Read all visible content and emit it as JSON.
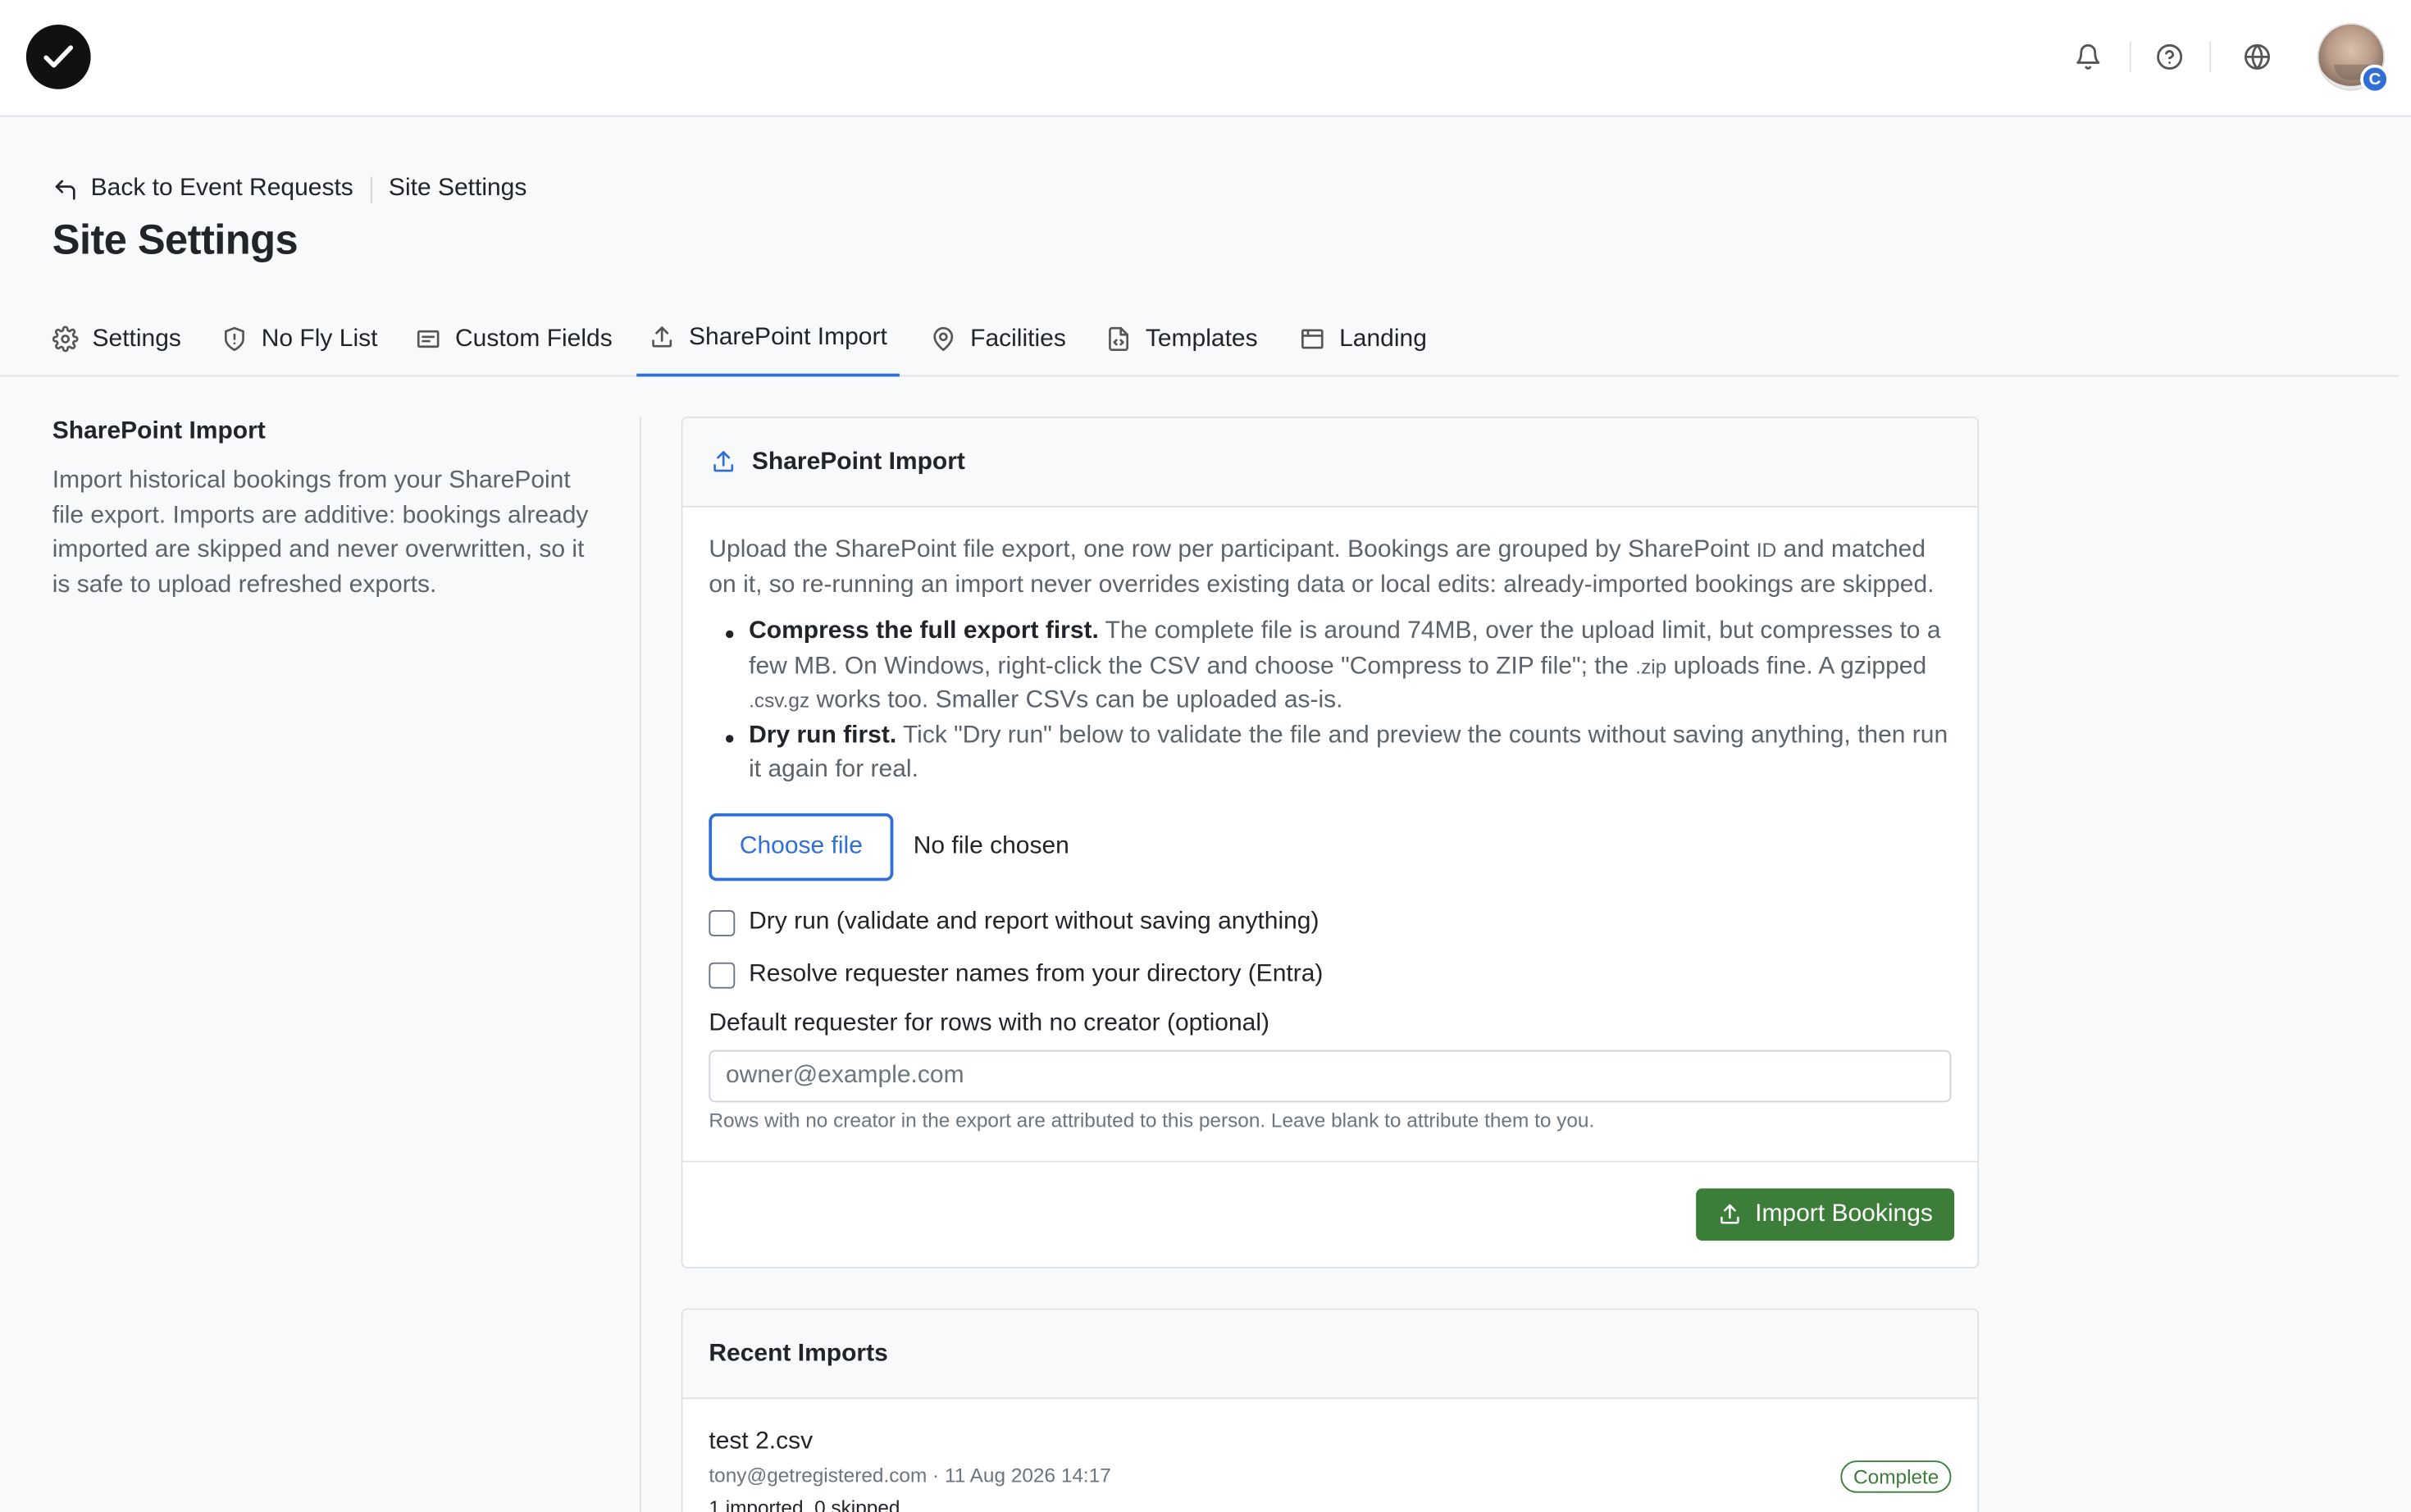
{
  "topbar": {
    "icons": [
      "bell-icon",
      "help-circle-icon",
      "globe-icon"
    ],
    "avatar_badge": "C"
  },
  "breadcrumb": {
    "back_label": "Back to Event Requests",
    "current": "Site Settings"
  },
  "page_title": "Site Settings",
  "tabs": [
    {
      "label": "Settings",
      "icon": "gear-icon"
    },
    {
      "label": "No Fly List",
      "icon": "shield-icon"
    },
    {
      "label": "Custom Fields",
      "icon": "form-icon"
    },
    {
      "label": "SharePoint Import",
      "icon": "upload-icon",
      "active": true
    },
    {
      "label": "Facilities",
      "icon": "map-pin-icon"
    },
    {
      "label": "Templates",
      "icon": "file-code-icon"
    },
    {
      "label": "Landing",
      "icon": "browser-window-icon"
    }
  ],
  "side": {
    "title": "SharePoint Import",
    "description": "Import historical bookings from your SharePoint file export. Imports are additive: bookings already imported are skipped and never overwritten, so it is safe to upload refreshed exports."
  },
  "card": {
    "title": "SharePoint Import",
    "intro_before": "Upload the SharePoint file export, one row per participant. Bookings are grouped by SharePoint ",
    "intro_id": "ID",
    "intro_after": " and matched on it, so re-running an import never overrides existing data or local edits: already-imported bookings are skipped.",
    "tip1_bold": "Compress the full export first.",
    "tip1_text_a": " The complete file is around 74MB, over the upload limit, but compresses to a few MB. On Windows, right-click the CSV and choose \"Compress to ZIP file\"; the ",
    "tip1_zip": ".zip",
    "tip1_text_b": " uploads fine. A gzipped ",
    "tip1_gz": ".csv.gz",
    "tip1_text_c": " works too. Smaller CSVs can be uploaded as-is.",
    "tip2_bold": "Dry run first.",
    "tip2_text": " Tick \"Dry run\" below to validate the file and preview the counts without saving anything, then run it again for real.",
    "choose_file_label": "Choose file",
    "file_status": "No file chosen",
    "dry_run_label": "Dry run (validate and report without saving anything)",
    "resolve_names_label": "Resolve requester names from your directory (Entra)",
    "default_requester_label": "Default requester for rows with no creator (optional)",
    "default_requester_value": "",
    "default_requester_placeholder": "owner@example.com",
    "help_text": "Rows with no creator in the export are attributed to this person. Leave blank to attribute them to you.",
    "import_button_label": "Import Bookings"
  },
  "recent": {
    "title": "Recent Imports",
    "items": [
      {
        "file_name": "test 2.csv",
        "meta": "tony@getregistered.com · 11 Aug 2026 14:17",
        "counts": "1 imported, 0 skipped",
        "status": "Complete"
      }
    ]
  },
  "colors": {
    "accent": "#2f6fd6",
    "success": "#3d7d3a"
  }
}
